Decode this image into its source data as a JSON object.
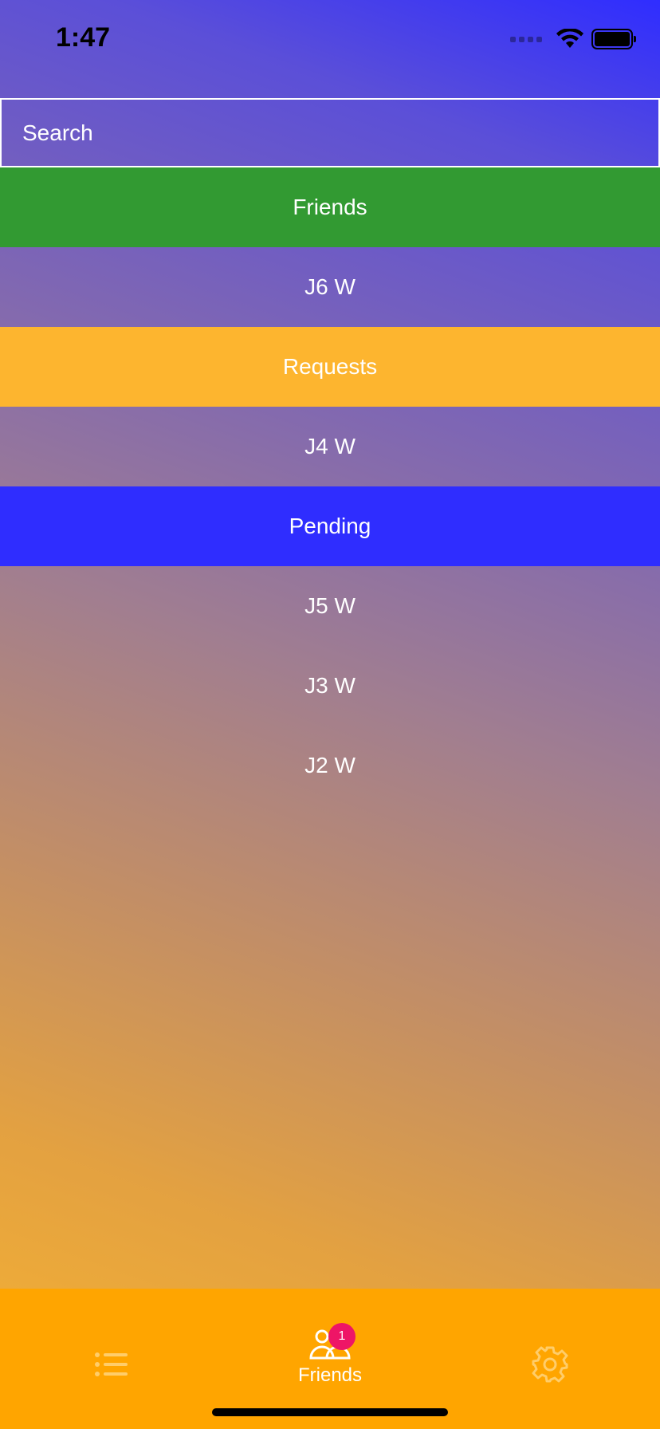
{
  "status_bar": {
    "time": "1:47"
  },
  "search": {
    "placeholder": "Search"
  },
  "list": {
    "rows": [
      {
        "label": "Friends",
        "kind": "section",
        "color": "#329a32"
      },
      {
        "label": "J6 W",
        "kind": "item"
      },
      {
        "label": "Requests",
        "kind": "section",
        "color": "#fdb52f"
      },
      {
        "label": "J4 W",
        "kind": "item"
      },
      {
        "label": "Pending",
        "kind": "section",
        "color": "#2f2dff"
      },
      {
        "label": "J5 W",
        "kind": "item"
      },
      {
        "label": "J3 W",
        "kind": "item"
      },
      {
        "label": "J2 W",
        "kind": "item"
      }
    ]
  },
  "tabbar": {
    "background": "#ffa500",
    "tabs": [
      {
        "icon": "list-icon",
        "label": ""
      },
      {
        "icon": "friends-icon",
        "label": "Friends",
        "badge": "1",
        "selected": true
      },
      {
        "icon": "gear-icon",
        "label": ""
      }
    ]
  }
}
